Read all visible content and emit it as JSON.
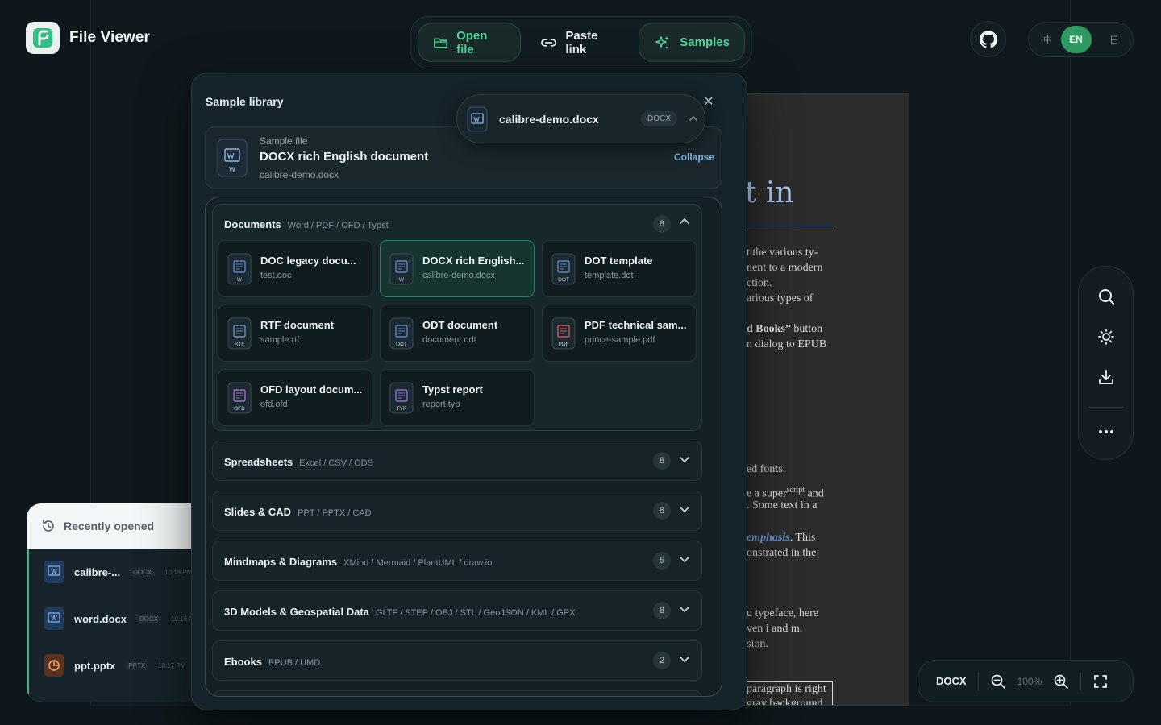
{
  "brand": {
    "name": "File Viewer"
  },
  "header": {
    "open_file": "Open file",
    "paste_link": "Paste link",
    "samples": "Samples",
    "lang_zh": "中",
    "lang_en": "EN",
    "lang_end": "日"
  },
  "panel": {
    "title": "Sample library",
    "close": "✕",
    "selected": {
      "kicker": "Sample file",
      "title": "DOCX rich English document",
      "file": "calibre-demo.docx",
      "collapse": "Collapse",
      "icon_tag": "W"
    },
    "pill": {
      "name": "calibre-demo.docx",
      "ext": "DOCX"
    },
    "groups": [
      {
        "title": "Documents",
        "sub": "Word / PDF / OFD / Typst",
        "count": "8",
        "open": true,
        "items": [
          {
            "title": "DOC legacy docu...",
            "file": "test.doc",
            "tag": "W",
            "color": "#5b86c8"
          },
          {
            "title": "DOCX rich English...",
            "file": "calibre-demo.docx",
            "tag": "W",
            "color": "#5b86c8",
            "active": true
          },
          {
            "title": "DOT template",
            "file": "template.dot",
            "tag": "DOT",
            "color": "#5b86c8"
          },
          {
            "title": "RTF document",
            "file": "sample.rtf",
            "tag": "RTF",
            "color": "#6d8fb8"
          },
          {
            "title": "ODT document",
            "file": "document.odt",
            "tag": "ODT",
            "color": "#5b86c8"
          },
          {
            "title": "PDF technical sam...",
            "file": "prince-sample.pdf",
            "tag": "PDF",
            "color": "#d05a5a"
          },
          {
            "title": "OFD layout docum...",
            "file": "ofd.ofd",
            "tag": "OFD",
            "color": "#a36cc9"
          },
          {
            "title": "Typst report",
            "file": "report.typ",
            "tag": "TYP",
            "color": "#8d6fd8"
          }
        ]
      },
      {
        "title": "Spreadsheets",
        "sub": "Excel / CSV / ODS",
        "count": "8"
      },
      {
        "title": "Slides & CAD",
        "sub": "PPT / PPTX / CAD",
        "count": "8"
      },
      {
        "title": "Mindmaps & Diagrams",
        "sub": "XMind / Mermaid / PlantUML / draw.io",
        "count": "5"
      },
      {
        "title": "3D Models & Geospatial Data",
        "sub": "GLTF / STEP / OBJ / STL / GeoJSON / KML / GPX",
        "count": "8"
      },
      {
        "title": "Ebooks",
        "sub": "EPUB / UMD",
        "count": "2"
      }
    ]
  },
  "recent": {
    "title": "Recently opened",
    "items": [
      {
        "name": "calibre-...",
        "ext": "DOCX",
        "time": "10:18 PM"
      },
      {
        "name": "word.docx",
        "ext": "DOCX",
        "time": "10:18 PM"
      },
      {
        "name": "ppt.pptx",
        "ext": "PPTX",
        "time": "10:17 PM"
      }
    ]
  },
  "document": {
    "title": "t in",
    "lines_a": [
      "t the various ty-",
      "nent to a modern",
      "ction.",
      "arious types of"
    ],
    "bold_line_bold": "d Books”",
    "bold_line_rest": " button",
    "line_dialog": "n dialog to EPUB",
    "line_fonts": "ed fonts.",
    "line_super_a": "e a super",
    "line_super_sup": "script",
    "line_super_b": " and",
    "line_some": ". Some text in a",
    "line_emph_i": "emphasis",
    "line_emph_rest": ". This",
    "line_onstr": "onstrated in the",
    "line_typeface": "u typeface, here",
    "line_even": "ven i and m.",
    "line_sion": "sion.",
    "line_para": "paragraph is right",
    "line_gray": "gray background"
  },
  "zoom": {
    "format": "DOCX",
    "level": "100%"
  },
  "colors": {
    "accent_green": "#53d49a",
    "link_blue": "#7fb3e6",
    "en_green": "#2e9a62"
  }
}
